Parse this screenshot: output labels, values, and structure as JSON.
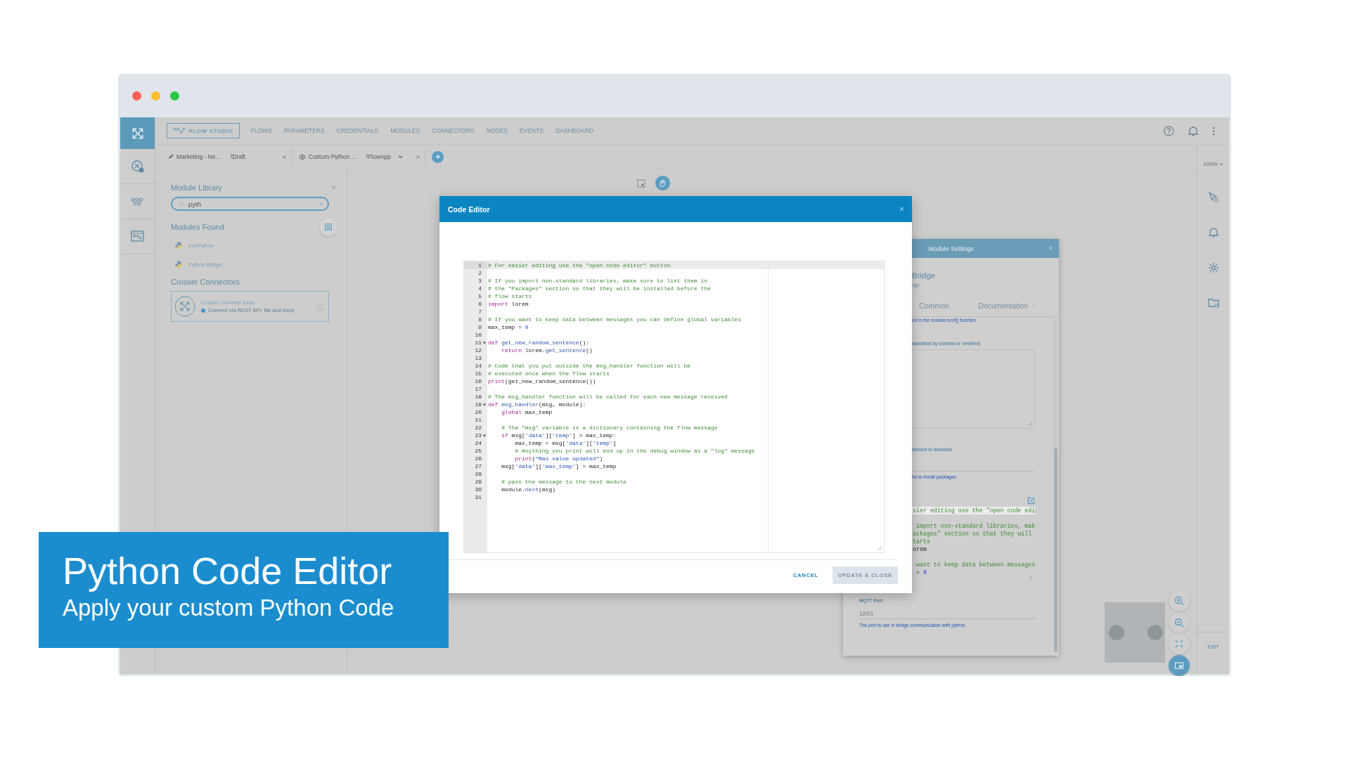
{
  "window": {
    "buttons": [
      {
        "color": "#fc5f57"
      },
      {
        "color": "#fdbc2e"
      },
      {
        "color": "#28c840"
      }
    ]
  },
  "top_nav": {
    "studio_button": "FLOW STUDIO",
    "items": [
      "FLOWS",
      "PARAMETERS",
      "CREDENTIALS",
      "MODULES",
      "CONNECTORS",
      "NODES",
      "EVENTS",
      "DASHBOARD"
    ]
  },
  "tabs": [
    {
      "kind": "edit",
      "title": "Marketing - Ne...",
      "path": "/Draft",
      "dropdown": false
    },
    {
      "kind": "view",
      "title": "Custom Python ...",
      "path": "/FlowApp",
      "dropdown": true
    }
  ],
  "right_rail": {
    "zoom_level": "100%",
    "exit": "EXIT"
  },
  "module_library": {
    "title": "Module Library",
    "search": {
      "value": "pyth"
    },
    "found_title": "Modules Found",
    "modules": [
      {
        "name": "IronPython"
      },
      {
        "name": "Python Bridge"
      }
    ],
    "connectors_title": "Crosser Connectors",
    "connector": {
      "title": "Crosser Connect Tools",
      "description": "Connect via REST API, file and more"
    }
  },
  "code_editor": {
    "title": "Code Editor",
    "lines": [
      {
        "number": "1",
        "active": true,
        "foldable": false,
        "segments": [
          {
            "kind": "comment",
            "text": "# For easier editing use the \"open code editor\" button"
          }
        ]
      },
      {
        "number": "2",
        "active": false,
        "foldable": false
      },
      {
        "number": "3",
        "active": false,
        "foldable": false,
        "segments": [
          {
            "kind": "comment",
            "text": "# If you import non-standard libraries, make sure to list them in"
          }
        ]
      },
      {
        "number": "4",
        "active": false,
        "foldable": false,
        "segments": [
          {
            "kind": "comment",
            "text": "# the \"Packages\" section so that they will be installed before the"
          }
        ]
      },
      {
        "number": "5",
        "active": false,
        "foldable": false,
        "segments": [
          {
            "kind": "comment",
            "text": "# flow starts"
          }
        ]
      },
      {
        "number": "6",
        "active": false,
        "foldable": false,
        "segments": [
          {
            "kind": "keyword",
            "text": "import"
          },
          {
            "kind": "plain",
            "text": " lorem"
          }
        ]
      },
      {
        "number": "7",
        "active": false,
        "foldable": false
      },
      {
        "number": "8",
        "active": false,
        "foldable": false,
        "segments": [
          {
            "kind": "comment",
            "text": "# If you want to keep data between messages you can define global variables"
          }
        ]
      },
      {
        "number": "9",
        "active": false,
        "foldable": false,
        "segments": [
          {
            "kind": "plain",
            "text": "max_temp = "
          },
          {
            "kind": "number",
            "text": "0"
          }
        ]
      },
      {
        "number": "10",
        "active": false,
        "foldable": false
      },
      {
        "number": "11",
        "active": false,
        "foldable": true,
        "segments": [
          {
            "kind": "keyword",
            "text": "def "
          },
          {
            "kind": "name",
            "text": "get_new_random_sentence"
          },
          {
            "kind": "plain",
            "text": "():"
          }
        ]
      },
      {
        "number": "12",
        "active": false,
        "foldable": false,
        "segments": [
          {
            "kind": "keyword",
            "text": "    return"
          },
          {
            "kind": "plain",
            "text": " lorem."
          },
          {
            "kind": "name",
            "text": "get_sentence"
          },
          {
            "kind": "plain",
            "text": "()"
          }
        ]
      },
      {
        "number": "13",
        "active": false,
        "foldable": false
      },
      {
        "number": "14",
        "active": false,
        "foldable": false,
        "segments": [
          {
            "kind": "comment",
            "text": "# Code that you put outside the msg_handler function will be"
          }
        ]
      },
      {
        "number": "15",
        "active": false,
        "foldable": false,
        "segments": [
          {
            "kind": "comment",
            "text": "# executed once when the flow starts"
          }
        ]
      },
      {
        "number": "16",
        "active": false,
        "foldable": false,
        "segments": [
          {
            "kind": "keyword",
            "text": "print"
          },
          {
            "kind": "plain",
            "text": "(get_new_random_sentence())"
          }
        ]
      },
      {
        "number": "17",
        "active": false,
        "foldable": false
      },
      {
        "number": "18",
        "active": false,
        "foldable": false,
        "segments": [
          {
            "kind": "comment",
            "text": "# The msg_handler function will be called for each new message received"
          }
        ]
      },
      {
        "number": "19",
        "active": false,
        "foldable": true,
        "segments": [
          {
            "kind": "keyword",
            "text": "def "
          },
          {
            "kind": "name",
            "text": "msg_handler"
          },
          {
            "kind": "plain",
            "text": "(msg, module):"
          }
        ]
      },
      {
        "number": "20",
        "active": false,
        "foldable": false,
        "segments": [
          {
            "kind": "keyword",
            "text": "    global"
          },
          {
            "kind": "plain",
            "text": " max_temp"
          }
        ]
      },
      {
        "number": "21",
        "active": false,
        "foldable": false
      },
      {
        "number": "22",
        "active": false,
        "foldable": false,
        "segments": [
          {
            "kind": "comment",
            "text": "    # The \"msg\" variable is a dictionary containing the flow message"
          }
        ]
      },
      {
        "number": "23",
        "active": false,
        "foldable": true,
        "segments": [
          {
            "kind": "keyword",
            "text": "    if"
          },
          {
            "kind": "plain",
            "text": " msg["
          },
          {
            "kind": "string",
            "text": "'data'"
          },
          {
            "kind": "plain",
            "text": "]["
          },
          {
            "kind": "string",
            "text": "'temp'"
          },
          {
            "kind": "plain",
            "text": "] > max_temp:"
          }
        ]
      },
      {
        "number": "24",
        "active": false,
        "foldable": false,
        "segments": [
          {
            "kind": "plain",
            "text": "        max_temp = msg["
          },
          {
            "kind": "string",
            "text": "'data'"
          },
          {
            "kind": "plain",
            "text": "]["
          },
          {
            "kind": "string",
            "text": "'temp'"
          },
          {
            "kind": "plain",
            "text": "]"
          }
        ]
      },
      {
        "number": "25",
        "active": false,
        "foldable": false,
        "segments": [
          {
            "kind": "comment",
            "text": "        # Anything you print will end up in the debug window as a \"log\" message"
          }
        ]
      },
      {
        "number": "26",
        "active": false,
        "foldable": false,
        "segments": [
          {
            "kind": "keyword",
            "text": "        print"
          },
          {
            "kind": "plain",
            "text": "("
          },
          {
            "kind": "string",
            "text": "\"Max value updated\""
          },
          {
            "kind": "plain",
            "text": ")"
          }
        ]
      },
      {
        "number": "27",
        "active": false,
        "foldable": false,
        "segments": [
          {
            "kind": "plain",
            "text": "    msg["
          },
          {
            "kind": "string",
            "text": "'data'"
          },
          {
            "kind": "plain",
            "text": "]["
          },
          {
            "kind": "string",
            "text": "'max_temp'"
          },
          {
            "kind": "plain",
            "text": "] = max_temp"
          }
        ]
      },
      {
        "number": "28",
        "active": false,
        "foldable": false
      },
      {
        "number": "29",
        "active": false,
        "foldable": false,
        "segments": [
          {
            "kind": "comment",
            "text": "    # pass the message to the next module"
          }
        ]
      },
      {
        "number": "30",
        "active": false,
        "foldable": false,
        "segments": [
          {
            "kind": "plain",
            "text": "    module."
          },
          {
            "kind": "name",
            "text": "next"
          },
          {
            "kind": "plain",
            "text": "(msg)"
          }
        ]
      },
      {
        "number": "31",
        "active": false,
        "foldable": false
      }
    ],
    "cancel": "CANCEL",
    "update": {
      "label": "UPDATE & CLOSE",
      "disabled": true
    }
  },
  "module_settings": {
    "title": "Module Settings",
    "name": "Bridge",
    "subtitle": "dge",
    "tabs": [
      {
        "label": "Common"
      },
      {
        "label": "Documentation"
      }
    ],
    "hint_top": "ed in the module.next() function.",
    "packages_label": "eparated by comma or newline)",
    "timeout_label": "imeout in seconds",
    "timeout_hint": "he to install packages.",
    "code_lines": [
      {
        "active": true,
        "segments": [
          {
            "kind": "comment",
            "text": "sier editing use the \"open code edi"
          }
        ]
      },
      {
        "active": false
      },
      {
        "active": false,
        "segments": [
          {
            "kind": "comment",
            "text": " import non-standard libraries, mak"
          }
        ]
      },
      {
        "active": false,
        "segments": [
          {
            "kind": "comment",
            "text": "ackages\" section so that they will"
          }
        ]
      },
      {
        "active": false,
        "segments": [
          {
            "kind": "comment",
            "text": "tarts"
          }
        ]
      },
      {
        "active": false,
        "segments": [
          {
            "kind": "plain",
            "text": "orem"
          }
        ]
      },
      {
        "active": false
      },
      {
        "active": false,
        "segments": [
          {
            "kind": "comment",
            "text": " want to keep data between messages"
          }
        ]
      },
      {
        "active": false,
        "segments": [
          {
            "kind": "plain",
            "text": " = "
          },
          {
            "kind": "number",
            "text": "0"
          }
        ]
      }
    ],
    "port": {
      "label": "MQTT Port",
      "placeholder": "1883",
      "hint": "The port to use in bridge communication with python."
    }
  },
  "banner": {
    "title": "Python Code Editor",
    "subtitle": "Apply your custom Python Code"
  }
}
